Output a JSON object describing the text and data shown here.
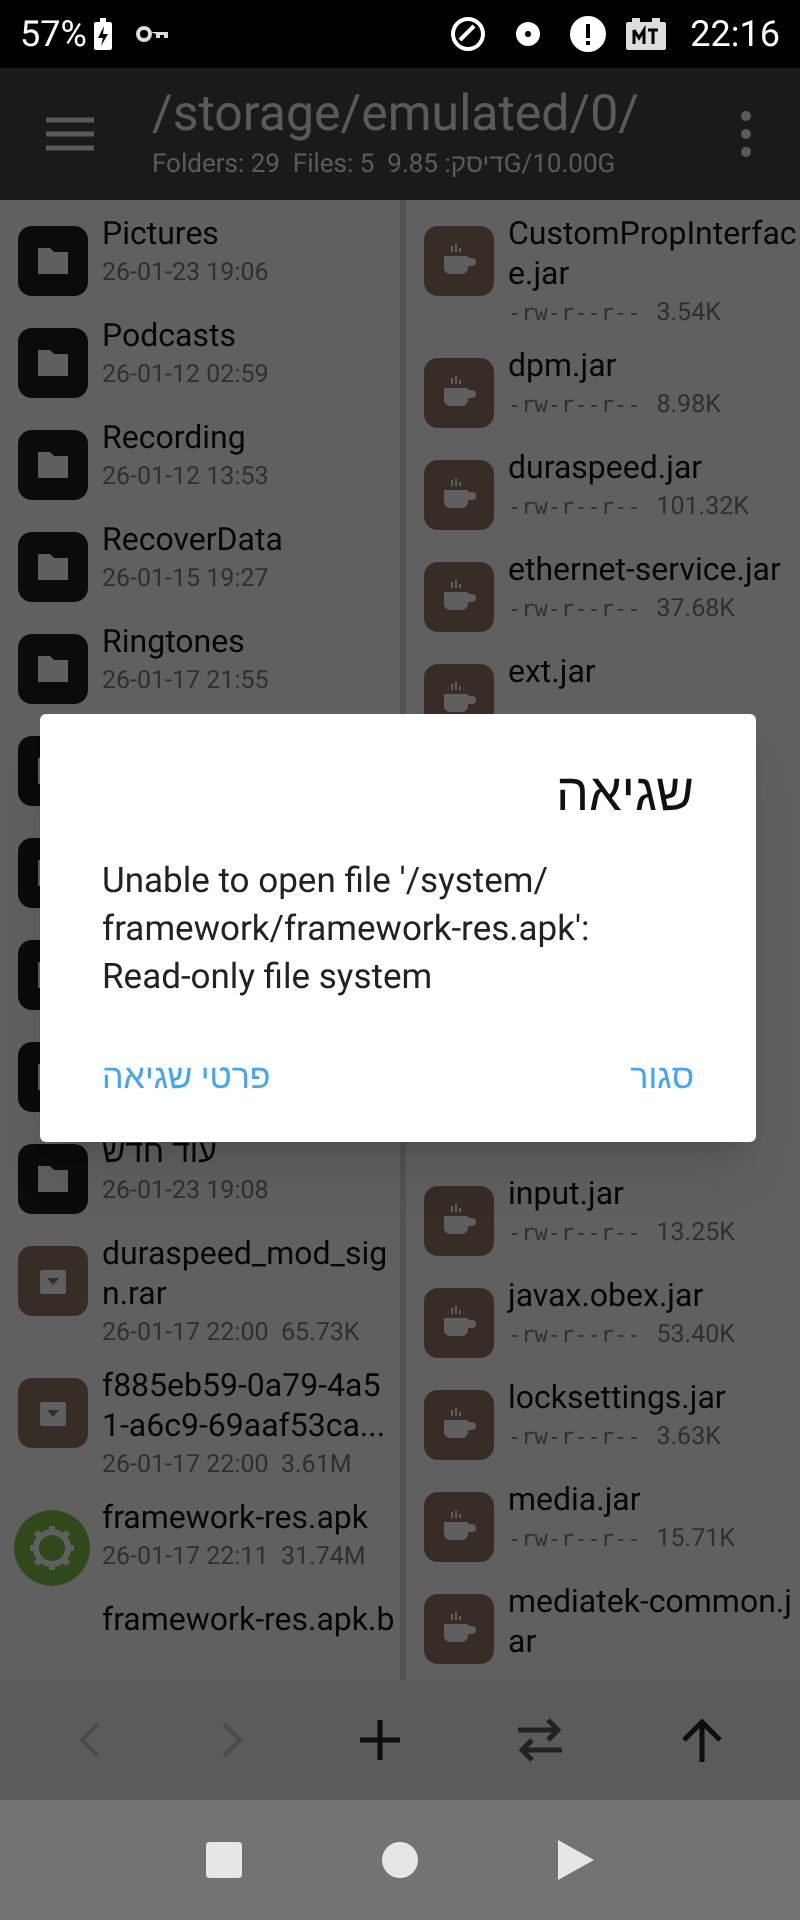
{
  "status_bar": {
    "battery": "57%",
    "time": "22:16"
  },
  "app_bar": {
    "title": "/storage/emulated/0/",
    "subtitle": "Folders: 29  Files: 5  9.85 :דיסקG/10.00G"
  },
  "left_pane": [
    {
      "kind": "folder",
      "name": "Pictures",
      "meta": "26-01-23 19:06"
    },
    {
      "kind": "folder",
      "name": "Podcasts",
      "meta": "26-01-12 02:59"
    },
    {
      "kind": "folder",
      "name": "Recording",
      "meta": "26-01-12 13:53"
    },
    {
      "kind": "folder",
      "name": "RecoverData",
      "meta": "26-01-15 19:27"
    },
    {
      "kind": "folder",
      "name": "Ringtones",
      "meta": "26-01-17 21:55"
    },
    {
      "kind": "folder"
    },
    {
      "kind": "folder"
    },
    {
      "kind": "folder"
    },
    {
      "kind": "folder"
    },
    {
      "kind": "folder",
      "name": "עוד חדש",
      "meta": "26-01-23 19:08"
    },
    {
      "kind": "archive",
      "name": "duraspeed_mod_sig\nn.rar",
      "meta": "26-01-17 22:00  65.73K"
    },
    {
      "kind": "archive",
      "name": "f885eb59-0a79-4a5\n1-a6c9-69aaf53ca...",
      "meta": "26-01-17 22:00  3.61M"
    },
    {
      "kind": "apk",
      "name": "framework-res.apk",
      "meta": "26-01-17 22:11  31.74M"
    },
    {
      "kind": "file",
      "name": "framework-res.apk.b"
    }
  ],
  "right_pane": [
    {
      "kind": "jar",
      "name": "CustomPropInterfac\ne.jar",
      "perms": "-rw-r--r--",
      "size": "3.54K"
    },
    {
      "kind": "jar",
      "name": "dpm.jar",
      "perms": "-rw-r--r--",
      "size": "8.98K"
    },
    {
      "kind": "jar",
      "name": "duraspeed.jar",
      "perms": "-rw-r--r--",
      "size": "101.32K"
    },
    {
      "kind": "jar",
      "name": "ethernet-service.jar",
      "perms": "-rw-r--r--",
      "size": "37.68K"
    },
    {
      "kind": "jar",
      "name": "ext.jar"
    },
    {
      "kind": "hidden"
    },
    {
      "kind": "jar",
      "name": "input.jar",
      "perms": "-rw-r--r--",
      "size": "13.25K"
    },
    {
      "kind": "jar",
      "name": "javax.obex.jar",
      "perms": "-rw-r--r--",
      "size": "53.40K"
    },
    {
      "kind": "jar",
      "name": "locksettings.jar",
      "perms": "-rw-r--r--",
      "size": "3.63K"
    },
    {
      "kind": "jar",
      "name": "media.jar",
      "perms": "-rw-r--r--",
      "size": "15.71K"
    },
    {
      "kind": "jar",
      "name": "mediatek-common.j\nar"
    }
  ],
  "dialog": {
    "title": "שגיאה",
    "message": "Unable to open file '/system/\nframework/framework-res.apk':\nRead-only file system",
    "buttons": [
      "סגור",
      "פרטי שגיאה"
    ]
  }
}
